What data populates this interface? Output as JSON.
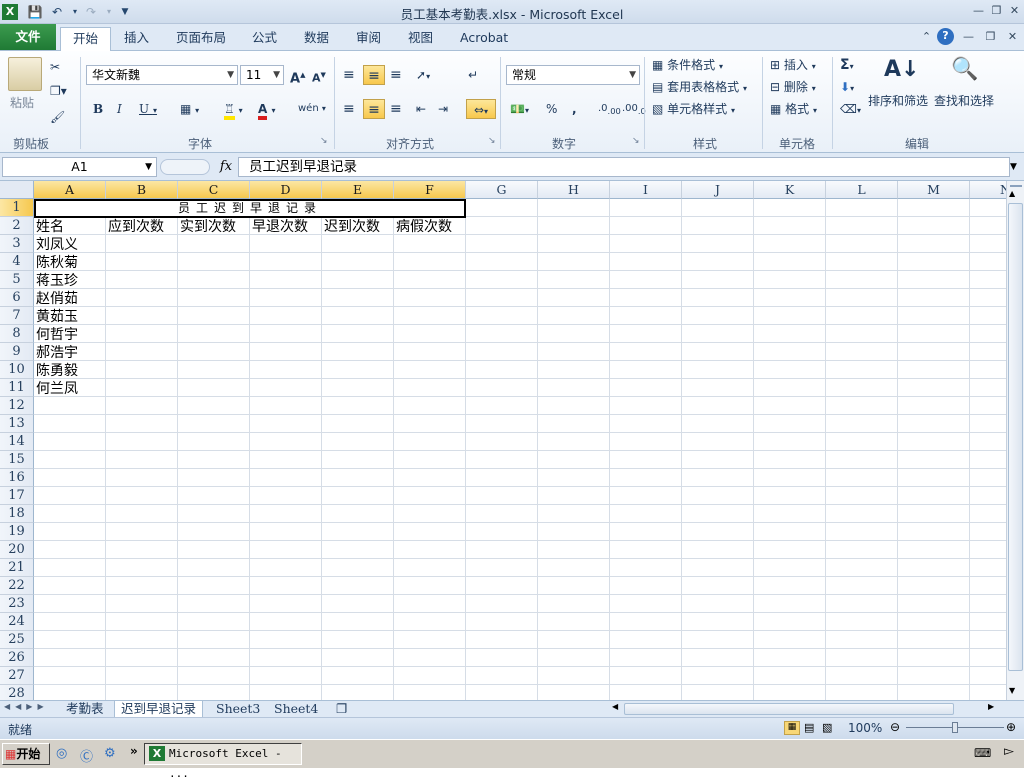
{
  "window": {
    "title": "员工基本考勤表.xlsx - Microsoft Excel"
  },
  "tabs": [
    "文件",
    "开始",
    "插入",
    "页面布局",
    "公式",
    "数据",
    "审阅",
    "视图",
    "Acrobat"
  ],
  "ribbon": {
    "clipboard": {
      "paste": "粘贴",
      "label": "剪贴板"
    },
    "font": {
      "name": "华文新魏",
      "size": "11",
      "label": "字体"
    },
    "alignment": {
      "label": "对齐方式"
    },
    "number": {
      "format": "常规",
      "label": "数字"
    },
    "styles": {
      "conditional": "条件格式",
      "table": "套用表格格式",
      "cell": "单元格样式",
      "label": "样式"
    },
    "cells": {
      "insert": "插入",
      "delete": "删除",
      "format": "格式",
      "label": "单元格"
    },
    "editing": {
      "sort": "排序和筛选",
      "find": "查找和选择",
      "label": "编辑"
    }
  },
  "formula_bar": {
    "name_box": "A1",
    "fx": "fx",
    "content": "员工迟到早退记录"
  },
  "columns": [
    "A",
    "B",
    "C",
    "D",
    "E",
    "F",
    "G",
    "H",
    "I",
    "J",
    "K",
    "L",
    "M",
    "N"
  ],
  "rows": [
    "1",
    "2",
    "3",
    "4",
    "5",
    "6",
    "7",
    "8",
    "9",
    "10",
    "11",
    "12",
    "13",
    "14",
    "15",
    "16",
    "17",
    "18",
    "19",
    "20",
    "21",
    "22",
    "23",
    "24",
    "25",
    "26",
    "27",
    "28"
  ],
  "sheet": {
    "merged_title": "员工迟到早退记录",
    "headers": [
      "姓名",
      "应到次数",
      "实到次数",
      "早退次数",
      "迟到次数",
      "病假次数"
    ],
    "names": [
      "刘凤义",
      "陈秋菊",
      "蒋玉珍",
      "赵俏茹",
      "黄茹玉",
      "何哲宇",
      "郝浩宇",
      "陈勇毅",
      "何兰凤"
    ]
  },
  "sheet_tabs": [
    "考勤表",
    "迟到早退记录",
    "Sheet3",
    "Sheet4"
  ],
  "status": {
    "ready": "就绪",
    "zoom": "100%"
  },
  "taskbar": {
    "start": "开始",
    "task": "Microsoft Excel - ..."
  }
}
